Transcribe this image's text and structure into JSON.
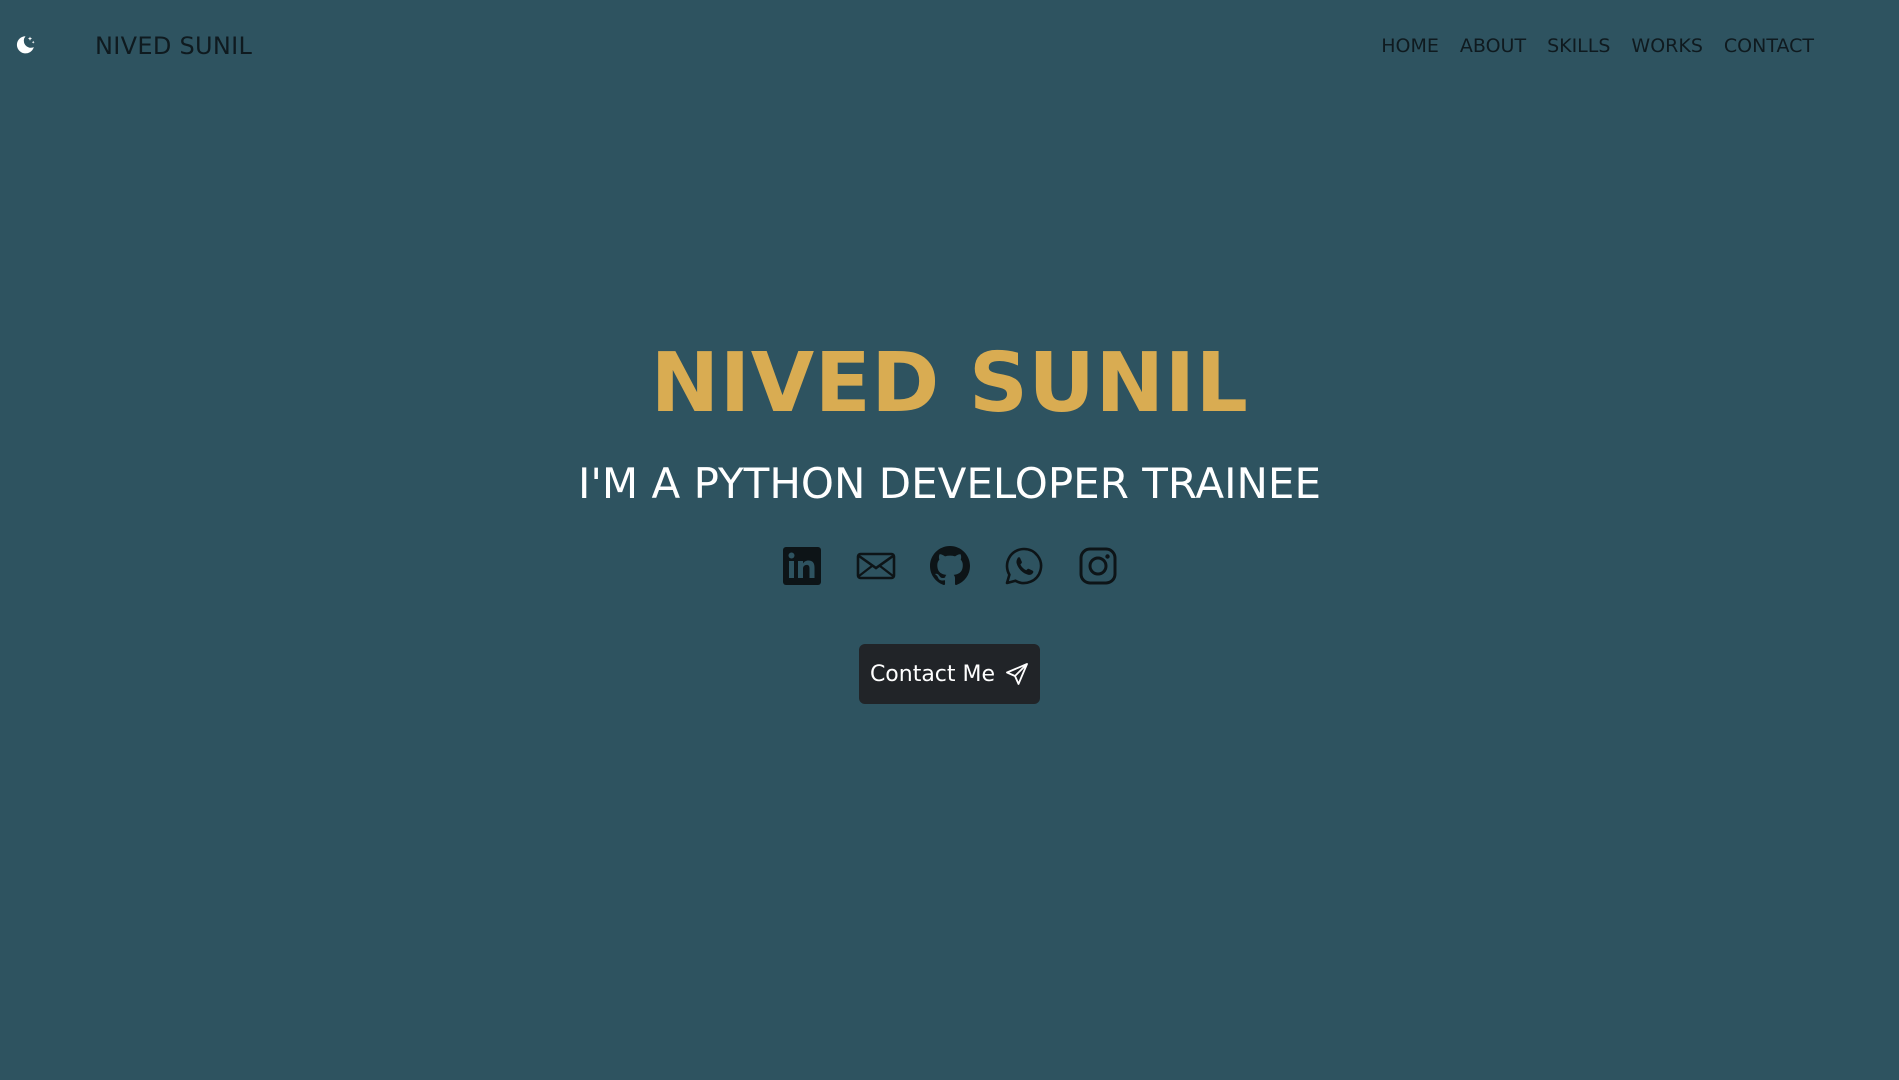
{
  "header": {
    "theme_toggle_icon": "moon-stars-icon",
    "brand": "NIVED SUNIL",
    "nav": [
      {
        "label": "HOME"
      },
      {
        "label": "ABOUT"
      },
      {
        "label": "SKILLS"
      },
      {
        "label": "WORKS"
      },
      {
        "label": "CONTACT"
      }
    ]
  },
  "hero": {
    "title": "NIVED SUNIL",
    "subtitle": "I'M A PYTHON DEVELOPER TRAINEE",
    "socials": [
      {
        "icon": "linkedin-icon"
      },
      {
        "icon": "email-icon"
      },
      {
        "icon": "github-icon"
      },
      {
        "icon": "whatsapp-icon"
      },
      {
        "icon": "instagram-icon"
      }
    ],
    "cta": {
      "label": "Contact Me",
      "icon": "send-icon"
    }
  },
  "colors": {
    "background": "#2e5360",
    "accent": "#d9ac52",
    "button": "#212428",
    "nav_text": "#0f1a1f"
  }
}
